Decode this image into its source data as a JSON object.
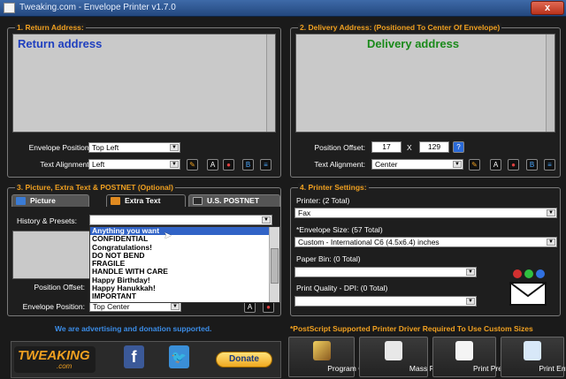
{
  "window": {
    "title": "Tweaking.com - Envelope Printer v1.7.0",
    "close": "x"
  },
  "return_panel": {
    "title": "1. Return Address:",
    "text": "Return address",
    "position_label": "Envelope Position:",
    "position_value": "Top Left",
    "alignment_label": "Text Alignment:",
    "alignment_value": "Left"
  },
  "delivery_panel": {
    "title": "2. Delivery Address: (Positioned To Center Of Envelope)",
    "text": "Delivery address",
    "offset_label": "Position Offset:",
    "offset_x": "17",
    "offset_sep": "X",
    "offset_y": "129",
    "help": "?",
    "alignment_label": "Text Alignment:",
    "alignment_value": "Center"
  },
  "extras_panel": {
    "title": "3. Picture, Extra Text & POSTNET (Optional)",
    "tabs": [
      "Picture",
      "Extra Text",
      "U.S. POSTNET"
    ],
    "history_label": "History & Presets:",
    "offset_label": "Position Offset:",
    "position_label": "Envelope Position:",
    "position_value": "Top Center",
    "presets": [
      "Anything you want",
      "CONFIDENTIAL",
      "Congratulations!",
      "DO NOT BEND",
      "FRAGILE",
      "HANDLE WITH CARE",
      "Happy Birthday!",
      "Happy Hanukkah!",
      "IMPORTANT"
    ]
  },
  "printer_panel": {
    "title": "4. Printer Settings:",
    "printer_label": "Printer: (2 Total)",
    "printer_value": "Fax",
    "size_label": "*Envelope Size: (57 Total)",
    "size_value": "Custom - International C6 (4.5x6.4) inches",
    "bin_label": "Paper Bin: (0 Total)",
    "bin_value": "",
    "quality_label": "Print Quality - DPI: (0 Total)",
    "quality_value": ""
  },
  "footer": {
    "ad_text": "We are advertising and donation supported.",
    "postscript_note": "*PostScript Supported Printer Driver Required To Use Custom Sizes",
    "logo_line1": "TWEAKING",
    "logo_line2": ".com",
    "donate": "Donate",
    "facebook": "f",
    "buttons": [
      "Program Colors",
      "Mass Print",
      "Print Preview",
      "Print Envelope"
    ]
  },
  "colors": {
    "accent": "#f0a020",
    "return_text": "#1f3fbf",
    "delivery_text": "#1a8a1a"
  }
}
